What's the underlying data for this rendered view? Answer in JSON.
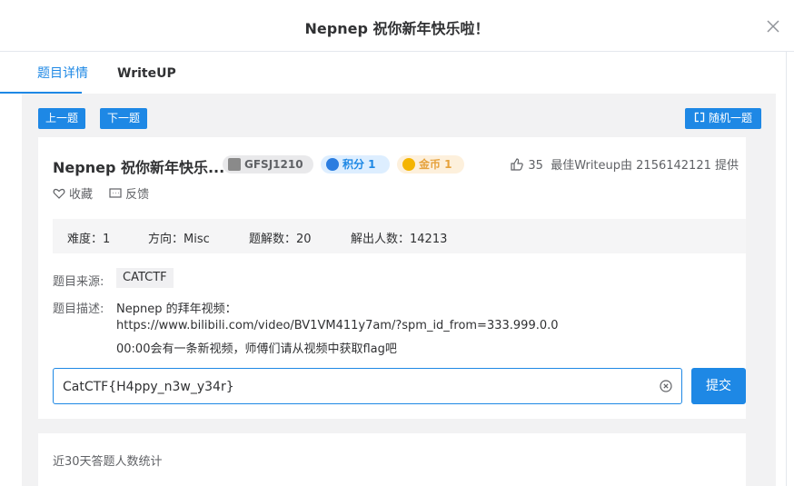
{
  "dialog": {
    "title": "Nepnep 祝你新年快乐啦！"
  },
  "tabs": [
    {
      "label": "题目详情",
      "active": true
    },
    {
      "label": "WriteUP",
      "active": false
    }
  ],
  "toolbar": {
    "prev_label": "上一题",
    "next_label": "下一题",
    "random_label": "随机一题"
  },
  "challenge": {
    "title": "Nepnep 祝你新年快乐...",
    "id_tag": "GFSJ1210",
    "score_tag": "积分 1",
    "coin_tag": "金币 1",
    "likes": "35",
    "best_writeup": "最佳Writeup由 2156142121 提供",
    "favorite_label": "收藏",
    "feedback_label": "反馈"
  },
  "stats": {
    "difficulty": "难度：1",
    "direction": "方向：Misc",
    "solves": "题解数：20",
    "solvers": "解出人数：14213"
  },
  "source": {
    "label": "题目来源:",
    "value": "CATCTF"
  },
  "description": {
    "label": "题目描述:",
    "lines": [
      "Nepnep 的拜年视频：",
      "https://www.bilibili.com/video/BV1VM411y7am/?spm_id_from=333.999.0.0",
      "00:00会有一条新视频，师傅们请从视频中获取flag吧"
    ]
  },
  "flag": {
    "value": "CatCTF{H4ppy_n3w_y34r}",
    "submit_label": "提交"
  },
  "stats_section": {
    "title": "近30天答题人数统计"
  },
  "colors": {
    "accent": "#1e88e5",
    "panel_bg": "#f2f2f3"
  }
}
